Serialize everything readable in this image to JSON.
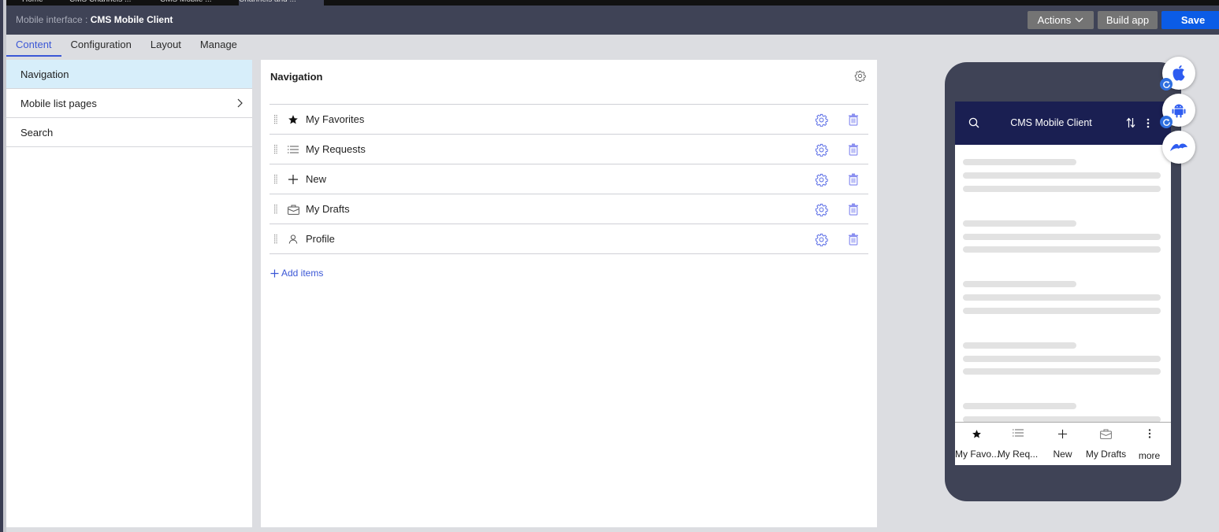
{
  "workspace_tabs": [
    "Home",
    "CMS Channels ...",
    "CMS Mobile ...",
    "Channels and ..."
  ],
  "header": {
    "title_prefix": "Mobile interface :",
    "title_name": "CMS Mobile Client",
    "actions_label": "Actions",
    "build_label": "Build app",
    "save_label": "Save"
  },
  "subtabs": [
    {
      "label": "Content",
      "active": true
    },
    {
      "label": "Configuration",
      "active": false
    },
    {
      "label": "Layout",
      "active": false
    },
    {
      "label": "Manage",
      "active": false
    }
  ],
  "left_panel": {
    "items": [
      {
        "label": "Navigation",
        "active": true
      },
      {
        "label": "Mobile list pages",
        "has_chevron": true
      },
      {
        "label": "Search"
      }
    ]
  },
  "main_panel": {
    "title": "Navigation",
    "rows": [
      {
        "label": "My Favorites",
        "icon": "star-icon"
      },
      {
        "label": "My Requests",
        "icon": "list-icon"
      },
      {
        "label": "New",
        "icon": "plus-icon"
      },
      {
        "label": "My Drafts",
        "icon": "briefcase-icon"
      },
      {
        "label": "Profile",
        "icon": "user-icon"
      }
    ],
    "add_items_label": "Add items"
  },
  "phone_preview": {
    "app_title": "CMS Mobile Client",
    "bottom_nav": [
      {
        "label": "My Favo...",
        "icon": "star-icon"
      },
      {
        "label": "My Req...",
        "icon": "list-icon"
      },
      {
        "label": "New",
        "icon": "plus-icon"
      },
      {
        "label": "My Drafts",
        "icon": "briefcase-icon"
      },
      {
        "label": "more",
        "icon": "more-vertical-icon"
      }
    ]
  },
  "platform_buttons": [
    "apple-icon",
    "android-icon",
    "bird-icon"
  ],
  "colors": {
    "header_bg": "#3f4356",
    "accent": "#3b57d6",
    "save": "#0b5ce6",
    "app_bar": "#1a1f52",
    "selected_nav": "#d7eefa"
  }
}
